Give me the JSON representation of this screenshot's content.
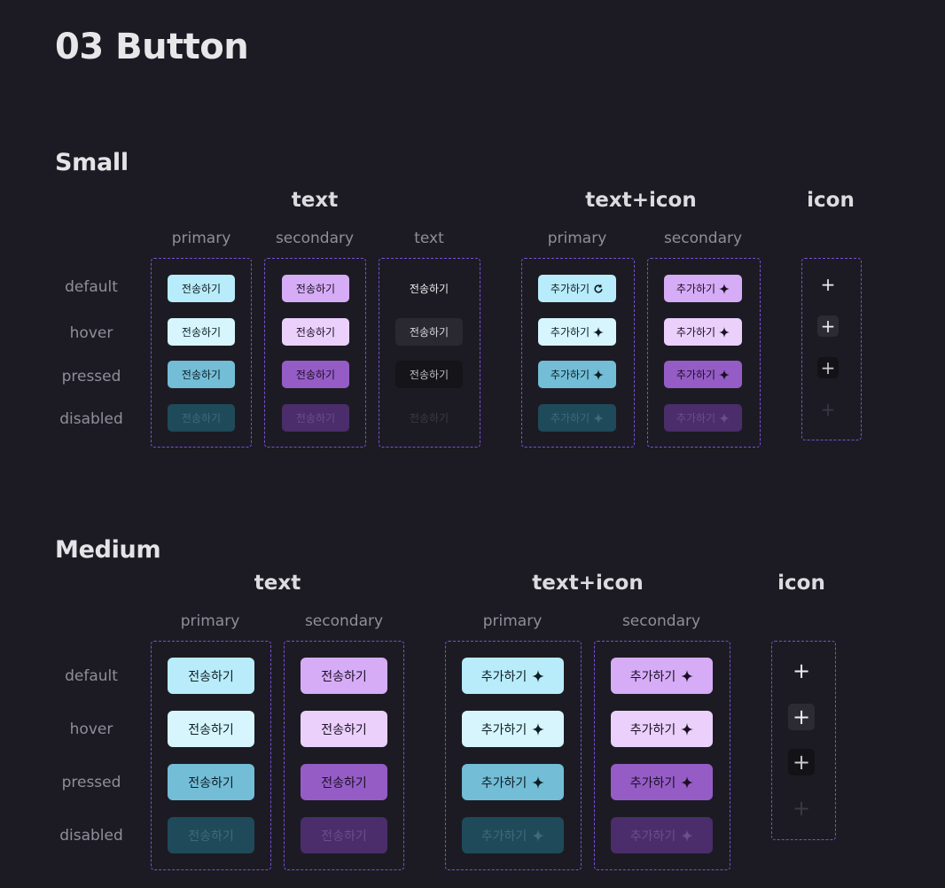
{
  "page_title": "03 Button",
  "sections": {
    "small": {
      "title": "Small",
      "groups": {
        "text": "text",
        "text_icon": "text+icon",
        "icon": "icon"
      },
      "columns": {
        "primary": "primary",
        "secondary": "secondary",
        "text": "text",
        "ti_primary": "primary",
        "ti_secondary": "secondary"
      },
      "rows": [
        "default",
        "hover",
        "pressed",
        "disabled"
      ],
      "send_label": "전송하기",
      "add_label": "추가하기"
    },
    "medium": {
      "title": "Medium",
      "groups": {
        "text": "text",
        "text_icon": "text+icon",
        "icon": "icon"
      },
      "columns": {
        "primary": "primary",
        "secondary": "secondary",
        "ti_primary": "primary",
        "ti_secondary": "secondary"
      },
      "rows": [
        "default",
        "hover",
        "pressed",
        "disabled"
      ],
      "send_label": "전송하기",
      "add_label": "추가하기"
    }
  },
  "icons": {
    "plus": "+",
    "sparkle": "sparkle-icon",
    "refresh": "refresh-icon"
  },
  "colors": {
    "background": "#1c1b23",
    "dashed_border": "#7a4fd6",
    "primary_default": "#b8ecfa",
    "primary_hover": "#d6f5fd",
    "primary_pressed": "#73bdd6",
    "primary_disabled": "#1f4a5a",
    "secondary_default": "#d6acf7",
    "secondary_hover": "#ead0fb",
    "secondary_pressed": "#955cc6",
    "secondary_disabled": "#4a2d6a"
  }
}
